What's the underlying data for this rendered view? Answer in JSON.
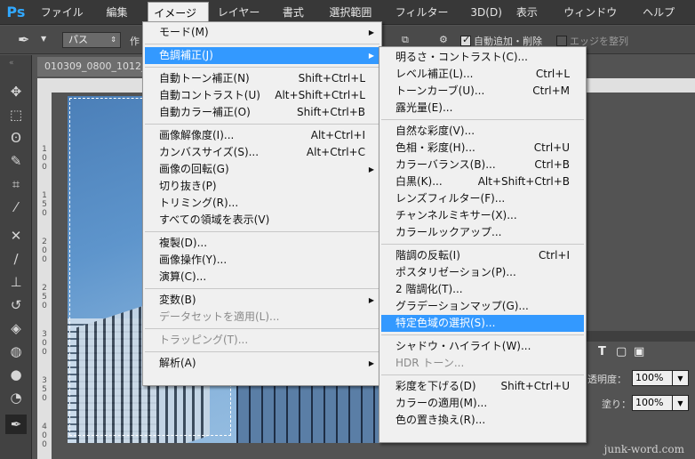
{
  "app": {
    "logo": "Ps"
  },
  "menubar": [
    {
      "label": "ファイル(F)"
    },
    {
      "label": "編集(E)"
    },
    {
      "label": "イメージ(I)"
    },
    {
      "label": "レイヤー(L)"
    },
    {
      "label": "書式(Y)"
    },
    {
      "label": "選択範囲(S)"
    },
    {
      "label": "フィルター(T)"
    },
    {
      "label": "3D(D)"
    },
    {
      "label": "表示(V)"
    },
    {
      "label": "ウィンドウ(W)"
    },
    {
      "label": "ヘルプ(H)"
    }
  ],
  "options": {
    "mode_select": "パス",
    "stub": "作",
    "auto_add_delete": "自動追加・削除",
    "align_edges": "エッジを整列"
  },
  "document": {
    "tab_title": "010309_0800_1012_"
  },
  "ruler_digits": [
    "1",
    "0",
    "0",
    "1",
    "5",
    "0",
    "2",
    "0",
    "0",
    "2",
    "5",
    "0",
    "3",
    "0",
    "0",
    "3",
    "5",
    "0",
    "4",
    "0",
    "0"
  ],
  "image_menu": [
    {
      "label": "モード(M)",
      "shortcut": "",
      "submenu": true
    },
    {
      "sep": true
    },
    {
      "label": "色調補正(J)",
      "shortcut": "",
      "submenu": true,
      "highlight": true
    },
    {
      "sep": true
    },
    {
      "label": "自動トーン補正(N)",
      "shortcut": "Shift+Ctrl+L"
    },
    {
      "label": "自動コントラスト(U)",
      "shortcut": "Alt+Shift+Ctrl+L"
    },
    {
      "label": "自動カラー補正(O)",
      "shortcut": "Shift+Ctrl+B"
    },
    {
      "sep": true
    },
    {
      "label": "画像解像度(I)...",
      "shortcut": "Alt+Ctrl+I"
    },
    {
      "label": "カンバスサイズ(S)...",
      "shortcut": "Alt+Ctrl+C"
    },
    {
      "label": "画像の回転(G)",
      "shortcut": "",
      "submenu": true
    },
    {
      "label": "切り抜き(P)",
      "shortcut": ""
    },
    {
      "label": "トリミング(R)...",
      "shortcut": ""
    },
    {
      "label": "すべての領域を表示(V)",
      "shortcut": ""
    },
    {
      "sep": true
    },
    {
      "label": "複製(D)...",
      "shortcut": ""
    },
    {
      "label": "画像操作(Y)...",
      "shortcut": ""
    },
    {
      "label": "演算(C)...",
      "shortcut": ""
    },
    {
      "sep": true
    },
    {
      "label": "変数(B)",
      "shortcut": "",
      "submenu": true
    },
    {
      "label": "データセットを適用(L)...",
      "shortcut": "",
      "disabled": true
    },
    {
      "sep": true
    },
    {
      "label": "トラッピング(T)...",
      "shortcut": "",
      "disabled": true
    },
    {
      "sep": true
    },
    {
      "label": "解析(A)",
      "shortcut": "",
      "submenu": true
    }
  ],
  "adjust_menu": [
    {
      "label": "明るさ・コントラスト(C)...",
      "shortcut": ""
    },
    {
      "label": "レベル補正(L)...",
      "shortcut": "Ctrl+L"
    },
    {
      "label": "トーンカーブ(U)...",
      "shortcut": "Ctrl+M"
    },
    {
      "label": "露光量(E)...",
      "shortcut": ""
    },
    {
      "sep": true
    },
    {
      "label": "自然な彩度(V)...",
      "shortcut": ""
    },
    {
      "label": "色相・彩度(H)...",
      "shortcut": "Ctrl+U"
    },
    {
      "label": "カラーバランス(B)...",
      "shortcut": "Ctrl+B"
    },
    {
      "label": "白黒(K)...",
      "shortcut": "Alt+Shift+Ctrl+B"
    },
    {
      "label": "レンズフィルター(F)...",
      "shortcut": ""
    },
    {
      "label": "チャンネルミキサー(X)...",
      "shortcut": ""
    },
    {
      "label": "カラールックアップ...",
      "shortcut": ""
    },
    {
      "sep": true
    },
    {
      "label": "階調の反転(I)",
      "shortcut": "Ctrl+I"
    },
    {
      "label": "ポスタリゼーション(P)...",
      "shortcut": ""
    },
    {
      "label": "2 階調化(T)...",
      "shortcut": ""
    },
    {
      "label": "グラデーションマップ(G)...",
      "shortcut": ""
    },
    {
      "label": "特定色域の選択(S)...",
      "shortcut": "",
      "highlight": true
    },
    {
      "sep": true
    },
    {
      "label": "シャドウ・ハイライト(W)...",
      "shortcut": ""
    },
    {
      "label": "HDR トーン...",
      "shortcut": "",
      "disabled": true
    },
    {
      "sep": true
    },
    {
      "label": "彩度を下げる(D)",
      "shortcut": "Shift+Ctrl+U"
    },
    {
      "label": "カラーの適用(M)...",
      "shortcut": ""
    },
    {
      "label": "色の置き換え(R)...",
      "shortcut": ""
    }
  ],
  "right_panel": {
    "opacity_label": "透明度：",
    "opacity_value": "100%",
    "fill_label": "塗り：",
    "fill_value": "100%",
    "type_glyph": "T"
  },
  "watermark": "junk-word.com",
  "colors": {
    "accent": "#3399ff",
    "logo": "#31a8ff",
    "menu_bg": "#f0f0f0"
  }
}
